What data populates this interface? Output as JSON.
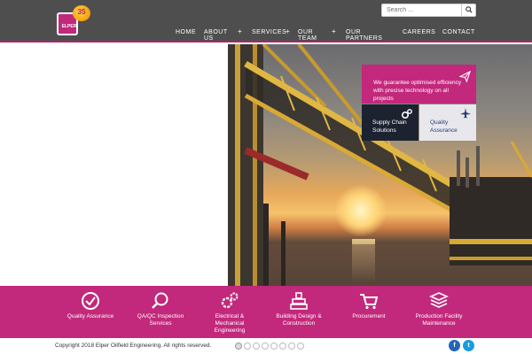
{
  "header": {
    "logo_text": "ELPER",
    "logo_badge": "35",
    "search_placeholder": "Search ...",
    "nav": [
      {
        "label": "HOME"
      },
      {
        "label": "ABOUT US"
      },
      {
        "label": "SERVICES"
      },
      {
        "label": "OUR TEAM"
      },
      {
        "label": "OUR PARTNERS"
      },
      {
        "label": "CAREERS"
      },
      {
        "label": "CONTACT"
      }
    ]
  },
  "hero": {
    "tagline": "We guarantee optimised efficiency with precise technology on all projects",
    "cards": [
      {
        "label": "Supply Chain Solutions",
        "icon": "gears-icon"
      },
      {
        "label": "Quality Assurance",
        "icon": "airplane-icon"
      }
    ]
  },
  "services": [
    {
      "label": "Quality Assurance",
      "icon": "check-badge-icon"
    },
    {
      "label": "QA/QC Inspection Services",
      "icon": "magnifier-icon"
    },
    {
      "label": "Electrical & Mechanical Engineering",
      "icon": "gears-icon"
    },
    {
      "label": "Building Design & Construction",
      "icon": "building-icon"
    },
    {
      "label": "Procurement",
      "icon": "cart-icon"
    },
    {
      "label": "Production Facility Maintenance",
      "icon": "stack-icon"
    }
  ],
  "footer": {
    "copyright": "Copyright 2018 Elper Oilfield Engineering. All rights reserved.",
    "slides_count": 8,
    "active_slide": 1,
    "social": [
      "facebook-icon",
      "twitter-icon"
    ]
  },
  "colors": {
    "brand": "#c2287b",
    "header_bg": "#4e4e4e",
    "dark_card": "#1c2230"
  }
}
